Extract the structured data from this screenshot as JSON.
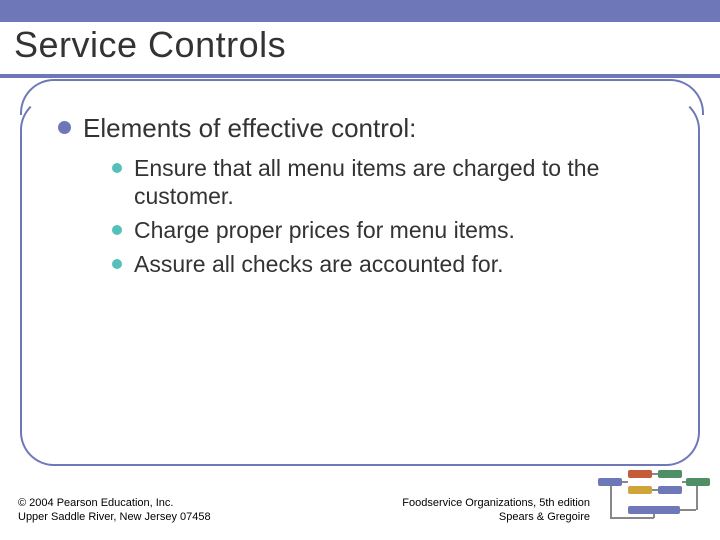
{
  "title": "Service Controls",
  "bullet1": "Elements of effective control:",
  "sub1": "Ensure that all menu items are charged to the customer.",
  "sub2": "Charge proper prices for menu items.",
  "sub3": "Assure all checks are accounted for.",
  "footer_left_line1": "© 2004 Pearson Education, Inc.",
  "footer_left_line2": "Upper Saddle River, New Jersey 07458",
  "footer_right_line1": "Foodservice Organizations, 5th edition",
  "footer_right_line2": "Spears & Gregoire"
}
